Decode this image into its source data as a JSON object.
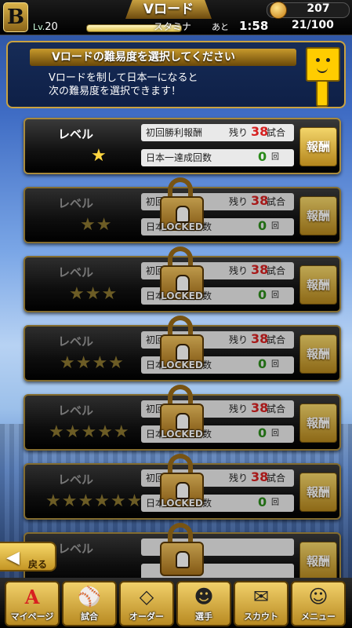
{
  "topbar": {
    "title": "Vロード",
    "level_prefix": "Lv.",
    "level_value": "20",
    "stamina_label": "スタミナ",
    "ato": "あと",
    "timer": "1:58",
    "stamina_count": "21/100",
    "coins": "207"
  },
  "header": {
    "title": "Vロードの難易度を選択してください",
    "description": "Vロードを制して日本一になると\n次の難易度を選択できます！"
  },
  "levels": [
    {
      "label": "レベル",
      "stars": "★",
      "locked": false,
      "first_win_label": "初回勝利報酬",
      "remain_label": "残り",
      "remain_value": "38",
      "remain_unit": "試合",
      "champion_label": "日本一達成回数",
      "champion_value": "0",
      "champion_unit": "回",
      "reward_label": "報酬"
    },
    {
      "label": "レベル",
      "stars": "★★",
      "locked": true,
      "lock_text": "LOCKED",
      "first_win_label": "初回勝利報酬",
      "remain_label": "残り",
      "remain_value": "38",
      "remain_unit": "試合",
      "champion_label": "日本一達成回数",
      "champion_value": "0",
      "champion_unit": "回",
      "reward_label": "報酬"
    },
    {
      "label": "レベル",
      "stars": "★★★",
      "locked": true,
      "lock_text": "LOCKED",
      "first_win_label": "初回勝利報酬",
      "remain_label": "残り",
      "remain_value": "38",
      "remain_unit": "試合",
      "champion_label": "日本一達成回数",
      "champion_value": "0",
      "champion_unit": "回",
      "reward_label": "報酬"
    },
    {
      "label": "レベル",
      "stars": "★★★★",
      "locked": true,
      "lock_text": "LOCKED",
      "first_win_label": "初回勝利報酬",
      "remain_label": "残り",
      "remain_value": "38",
      "remain_unit": "試合",
      "champion_label": "日本一達成回数",
      "champion_value": "0",
      "champion_unit": "回",
      "reward_label": "報酬"
    },
    {
      "label": "レベル",
      "stars": "★★★★★",
      "locked": true,
      "lock_text": "LOCKED",
      "first_win_label": "初回勝利報酬",
      "remain_label": "残り",
      "remain_value": "38",
      "remain_unit": "試合",
      "champion_label": "日本一達成回数",
      "champion_value": "0",
      "champion_unit": "回",
      "reward_label": "報酬"
    },
    {
      "label": "レベル",
      "stars": "★★★★★★",
      "locked": true,
      "lock_text": "LOCKED",
      "first_win_label": "初回勝利報酬",
      "remain_label": "残り",
      "remain_value": "38",
      "remain_unit": "試合",
      "champion_label": "日本一達成回数",
      "champion_value": "0",
      "champion_unit": "回",
      "reward_label": "報酬"
    },
    {
      "label": "レベル",
      "stars": "",
      "locked": true,
      "lock_text": "",
      "first_win_label": "",
      "remain_label": "",
      "remain_value": "",
      "remain_unit": "",
      "champion_label": "",
      "champion_value": "",
      "champion_unit": "",
      "reward_label": "報酬"
    }
  ],
  "back_label": "戻る",
  "nav": [
    {
      "label": "マイページ",
      "icon": "A"
    },
    {
      "label": "試合",
      "icon": "⚾"
    },
    {
      "label": "オーダー",
      "icon": "◇"
    },
    {
      "label": "選手",
      "icon": "☻"
    },
    {
      "label": "スカウト",
      "icon": "✉"
    },
    {
      "label": "メニュー",
      "icon": "☺"
    }
  ],
  "colors": {
    "accent_gold": "#caa240",
    "remain_red": "#d62020",
    "count_green": "#2a8a1a"
  }
}
